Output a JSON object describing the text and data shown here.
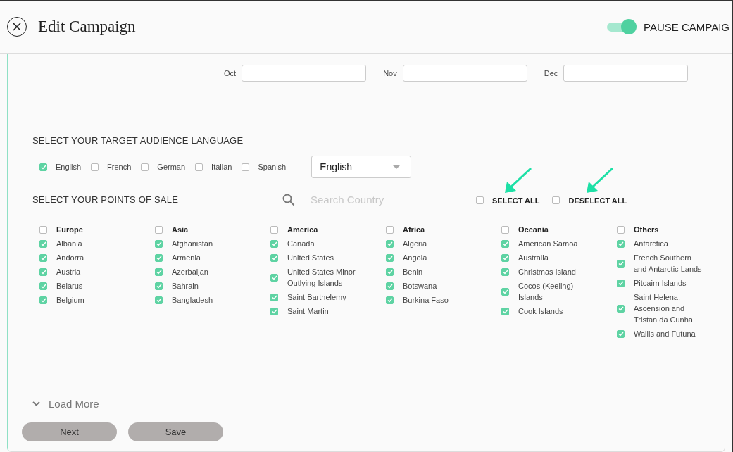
{
  "header": {
    "title": "Edit Campaign",
    "toggle": {
      "label": "PAUSE CAMPAIG",
      "on": true
    }
  },
  "months": [
    {
      "label": "Oct"
    },
    {
      "label": "Nov"
    },
    {
      "label": "Dec"
    }
  ],
  "language": {
    "heading": "SELECT YOUR TARGET AUDIENCE LANGUAGE",
    "options": [
      {
        "label": "English",
        "checked": true
      },
      {
        "label": "French",
        "checked": false
      },
      {
        "label": "German",
        "checked": false
      },
      {
        "label": "Italian",
        "checked": false
      },
      {
        "label": "Spanish",
        "checked": false
      }
    ],
    "dropdown": "English"
  },
  "points_of_sale": {
    "heading": "SELECT YOUR POINTS OF SALE",
    "search": {
      "placeholder": "Search Country"
    },
    "select_all": {
      "label": "SELECT ALL",
      "checked": false
    },
    "deselect_all": {
      "label": "DESELECT ALL",
      "checked": false
    },
    "regions": [
      {
        "name": "Europe",
        "checked": false,
        "countries": [
          {
            "name": "Albania",
            "checked": true
          },
          {
            "name": "Andorra",
            "checked": true
          },
          {
            "name": "Austria",
            "checked": true
          },
          {
            "name": "Belarus",
            "checked": true
          },
          {
            "name": "Belgium",
            "checked": true
          }
        ]
      },
      {
        "name": "Asia",
        "checked": false,
        "countries": [
          {
            "name": "Afghanistan",
            "checked": true
          },
          {
            "name": "Armenia",
            "checked": true
          },
          {
            "name": "Azerbaijan",
            "checked": true
          },
          {
            "name": "Bahrain",
            "checked": true
          },
          {
            "name": "Bangladesh",
            "checked": true
          }
        ]
      },
      {
        "name": "America",
        "checked": false,
        "countries": [
          {
            "name": "Canada",
            "checked": true
          },
          {
            "name": "United States",
            "checked": true
          },
          {
            "name": "United States Minor Outlying Islands",
            "checked": true
          },
          {
            "name": "Saint Barthelemy",
            "checked": true
          },
          {
            "name": "Saint Martin",
            "checked": true
          }
        ]
      },
      {
        "name": "Africa",
        "checked": false,
        "countries": [
          {
            "name": "Algeria",
            "checked": true
          },
          {
            "name": "Angola",
            "checked": true
          },
          {
            "name": "Benin",
            "checked": true
          },
          {
            "name": "Botswana",
            "checked": true
          },
          {
            "name": "Burkina Faso",
            "checked": true
          }
        ]
      },
      {
        "name": "Oceania",
        "checked": false,
        "countries": [
          {
            "name": "American Samoa",
            "checked": true
          },
          {
            "name": "Australia",
            "checked": true
          },
          {
            "name": "Christmas Island",
            "checked": true
          },
          {
            "name": "Cocos (Keeling) Islands",
            "checked": true
          },
          {
            "name": "Cook Islands",
            "checked": true
          }
        ]
      },
      {
        "name": "Others",
        "checked": false,
        "countries": [
          {
            "name": "Antarctica",
            "checked": true
          },
          {
            "name": "French Southern and Antarctic Lands",
            "checked": true
          },
          {
            "name": "Pitcairn Islands",
            "checked": true
          },
          {
            "name": "Saint Helena, Ascension and Tristan da Cunha",
            "checked": true
          },
          {
            "name": "Wallis and Futuna",
            "checked": true
          }
        ]
      }
    ]
  },
  "load_more": "Load More",
  "buttons": [
    "Next",
    "Save"
  ]
}
